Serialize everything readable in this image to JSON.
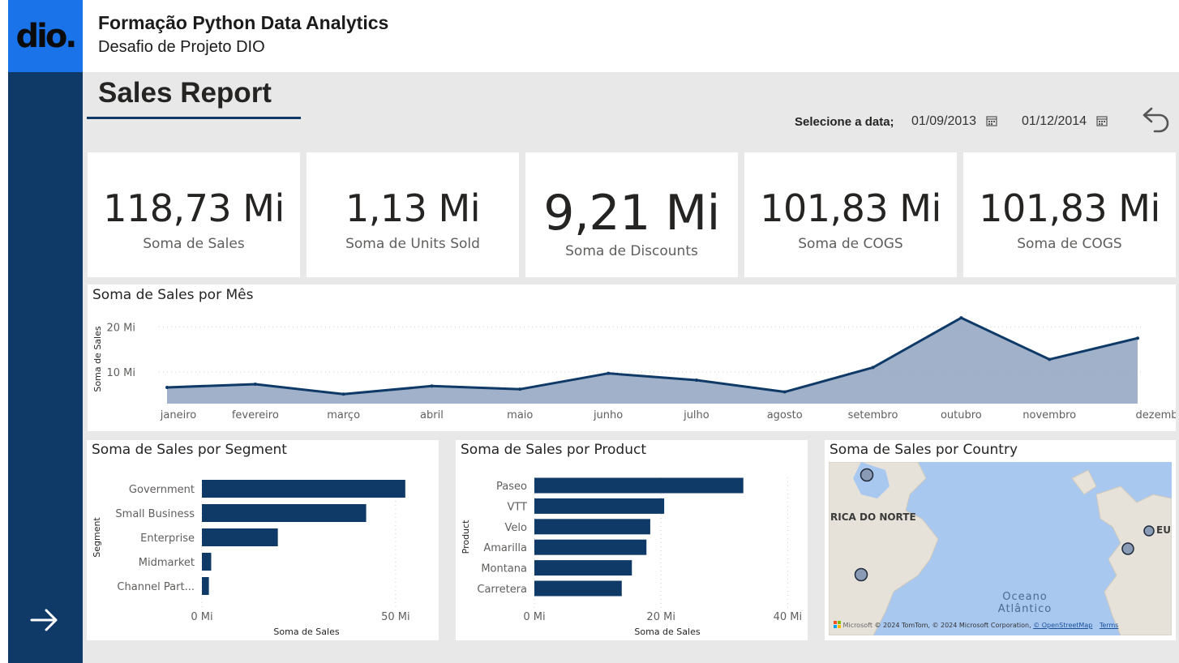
{
  "brand": {
    "logo_text": "dio.",
    "logo_color": "#1a73e8",
    "rail_color": "#0f3a68"
  },
  "header": {
    "title": "Formação Python Data Analytics",
    "subtitle": "Desafio de Projeto DIO"
  },
  "report": {
    "title": "Sales Report"
  },
  "date_filter": {
    "label": "Selecione a data;",
    "start": "01/09/2013",
    "end": "01/12/2014",
    "icon": "calendar-icon"
  },
  "cards": [
    {
      "value": "118,73 Mi",
      "label": "Soma de  Sales"
    },
    {
      "value": "1,13 Mi",
      "label": "Soma de Units Sold"
    },
    {
      "value": "9,21 Mi",
      "label": "Soma de Discounts"
    },
    {
      "value": "101,83 Mi",
      "label": "Soma de COGS"
    },
    {
      "value": "101,83 Mi",
      "label": "Soma de COGS"
    }
  ],
  "chart_data": [
    {
      "type": "area",
      "title": "Soma de Sales por Mês",
      "xlabel": "",
      "ylabel": "Soma de Sales",
      "categories": [
        "janeiro",
        "fevereiro",
        "março",
        "abril",
        "maio",
        "junho",
        "julho",
        "agosto",
        "setembro",
        "outubro",
        "novembro",
        "dezembro"
      ],
      "values": [
        6.6,
        7.3,
        5.1,
        6.9,
        6.2,
        9.7,
        8.2,
        5.6,
        11.0,
        22.0,
        12.8,
        17.5
      ],
      "yticks": [
        "10 Mi",
        "20 Mi"
      ],
      "ytick_values": [
        10,
        20
      ],
      "ylim": [
        3,
        24
      ],
      "unit": "Mi",
      "color": "#0f3a68"
    },
    {
      "type": "bar",
      "orientation": "horizontal",
      "title": "Soma de Sales por Segment",
      "xlabel": "Soma de Sales",
      "ylabel": "Segment",
      "categories": [
        "Government",
        "Small Business",
        "Enterprise",
        "Midmarket",
        "Channel Part..."
      ],
      "values": [
        52.5,
        42.4,
        19.6,
        2.4,
        1.8
      ],
      "xticks": [
        "0 Mi",
        "50 Mi"
      ],
      "xtick_values": [
        0,
        50
      ],
      "xlim": [
        0,
        54
      ],
      "color": "#0f3a68"
    },
    {
      "type": "bar",
      "orientation": "horizontal",
      "title": "Soma de Sales por Product",
      "xlabel": "Soma de Sales",
      "ylabel": "Product",
      "categories": [
        "Paseo",
        "VTT",
        "Velo",
        "Amarilla",
        "Montana",
        "Carretera"
      ],
      "values": [
        33.0,
        20.5,
        18.3,
        17.7,
        15.4,
        13.8
      ],
      "xticks": [
        "0 Mi",
        "20 Mi",
        "40 Mi"
      ],
      "xtick_values": [
        0,
        20,
        40
      ],
      "xlim": [
        0,
        42
      ],
      "color": "#0f3a68"
    }
  ],
  "map": {
    "title": "Soma de Sales por Country",
    "labels": {
      "continent": "RICA DO NORTE",
      "europe": "EU",
      "ocean_line1": "Oceano",
      "ocean_line2": "Atlântico"
    },
    "attribution": {
      "logo": "Microsoft",
      "text": "© 2024 TomTom, © 2024 Microsoft Corporation, ",
      "osm": "© OpenStreetMap",
      "terms": "Terms"
    }
  },
  "nav": {
    "next_icon": "arrow-right-icon",
    "back_icon": "undo-arrow-icon"
  }
}
